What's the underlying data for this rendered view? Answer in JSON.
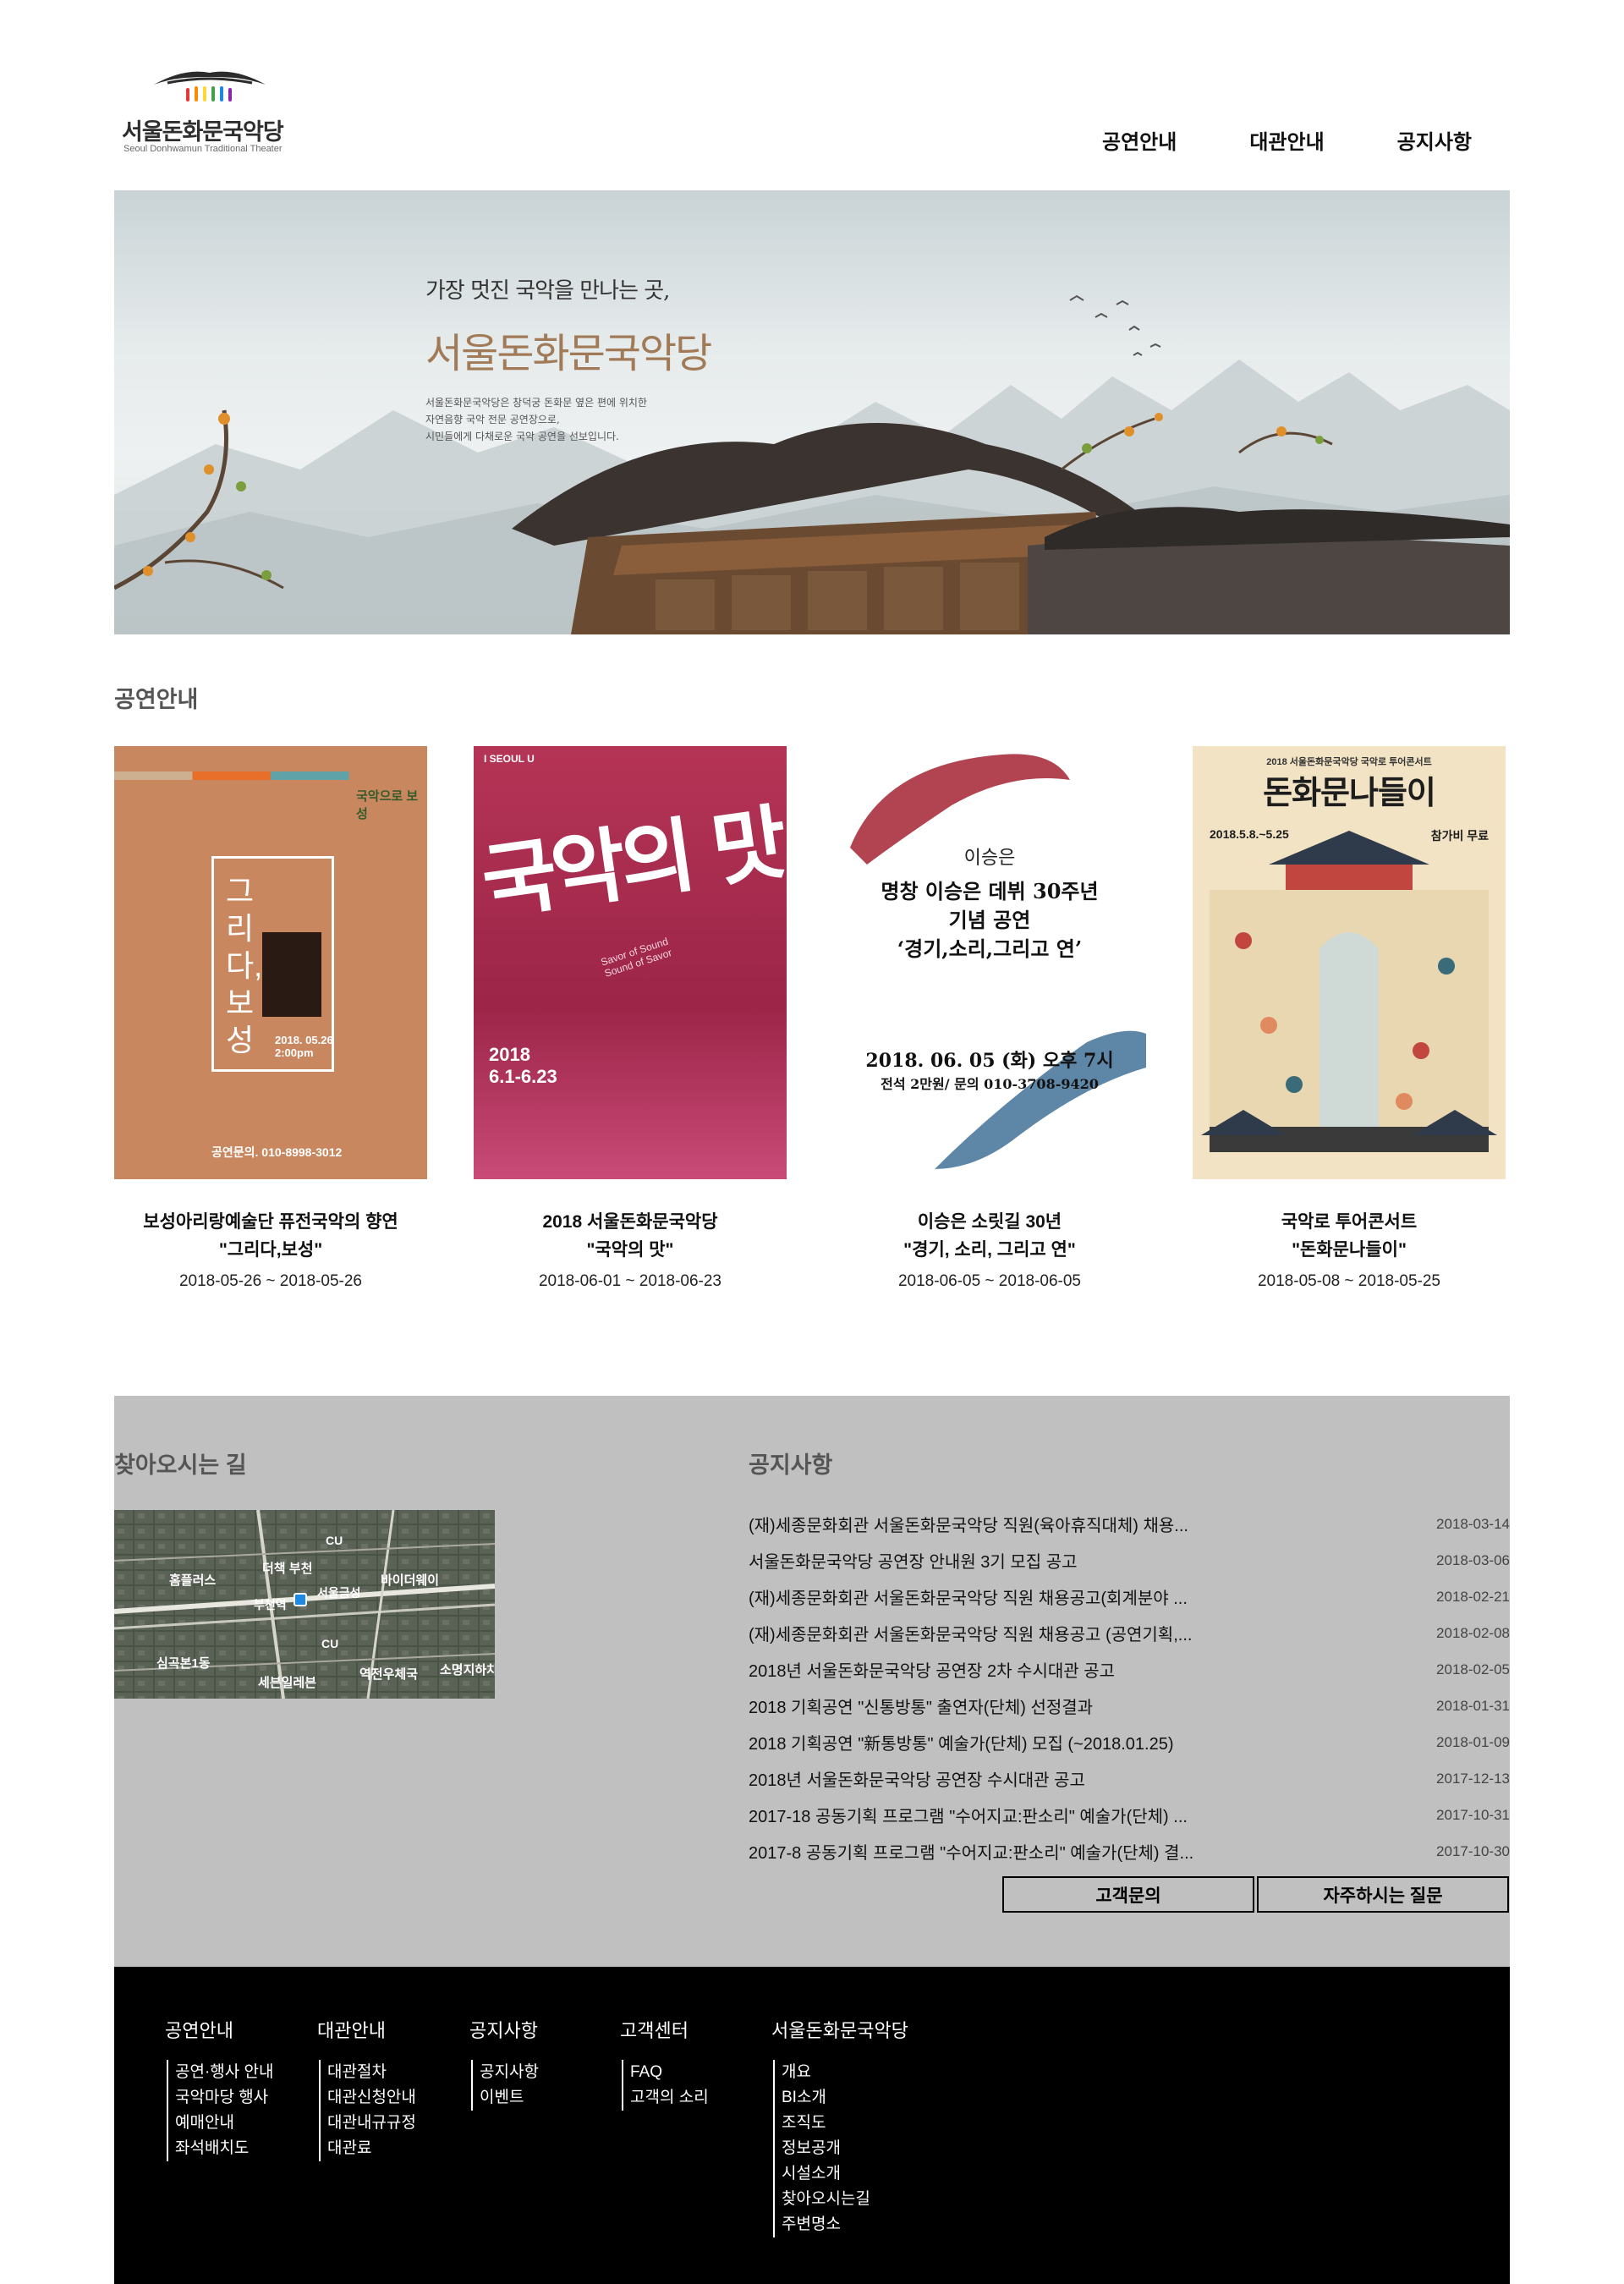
{
  "header": {
    "logo_name": "서울돈화문국악당",
    "logo_en": "Seoul Donhwamun Traditional Theater",
    "nav": [
      "공연안내",
      "대관안내",
      "공지사항"
    ]
  },
  "hero": {
    "subtitle": "가장 멋진 국악을 만나는 곳,",
    "title": "서울돈화문국악당",
    "desc_lines": [
      "서울돈화문국악당은 창덕궁 돈화문 옆은 편에 위치한",
      "자연음향 국악 전문 공연장으로,",
      "시민들에게 다채로운 국악 공연을 선보입니다."
    ]
  },
  "performances": {
    "title": "공연안내",
    "items": [
      {
        "name_line1": "보성아리랑예술단 퓨전국악의 향연",
        "name_line2": "\"그리다,보성\"",
        "date": "2018-05-26 ~ 2018-05-26",
        "poster": {
          "badge": "국악으로 보성",
          "vertical_title": "그리다,보성",
          "date_text": "2018. 05.26 2:00pm",
          "contact": "공연문의. 010-8998-3012",
          "bg": "#c8875f"
        }
      },
      {
        "name_line1": "2018 서울돈화문국악당",
        "name_line2": "\"국악의 맛\"",
        "date": "2018-06-01 ~ 2018-06-23",
        "poster": {
          "brand": "I SEOUL U",
          "big_title": "국악의 맛",
          "subtitle_en": "Savor of Sound Sound of Savor",
          "year": "2018",
          "period": "6.1-6.23",
          "bg": "#a2294a"
        }
      },
      {
        "name_line1": "이승은 소릿길 30년",
        "name_line2": "\"경기, 소리, 그리고 연\"",
        "date": "2018-06-05 ~ 2018-06-05",
        "poster": {
          "name": "이승은",
          "line1": "명창 이승은 데뷔 30주년",
          "line2": "기념 공연",
          "line3": "‘경기,소리,그리고 연’",
          "datetime": "2018. 06. 05 (화) 오후 7시",
          "price": "전석 2만원/ 문의 010-3708-9420",
          "bg": "#ffffff"
        }
      },
      {
        "name_line1": "국악로 투어콘서트",
        "name_line2": "\"돈화문나들이\"",
        "date": "2018-05-08 ~ 2018-05-25",
        "poster": {
          "top": "2018 서울돈화문국악당 국악로 투어콘서트",
          "big_title": "돈화문나들이",
          "period": "2018.5.8.~5.25",
          "free": "참가비 무료",
          "bg": "#f2e3c4"
        }
      }
    ]
  },
  "directions": {
    "title": "찾아오시는 길",
    "map_labels": [
      "CU",
      "더책 부천",
      "홈플러스",
      "바이더웨이",
      "서울금성",
      "부천역",
      "CU",
      "심곡본1동",
      "세븐일레븐",
      "역전우체국",
      "소명지하차"
    ]
  },
  "notices": {
    "title": "공지사항",
    "items": [
      {
        "text": "(재)세종문화회관 서울돈화문국악당 직원(육아휴직대체) 채용...",
        "date": "2018-03-14"
      },
      {
        "text": "서울돈화문국악당 공연장 안내원 3기 모집 공고",
        "date": "2018-03-06"
      },
      {
        "text": "(재)세종문화회관 서울돈화문국악당 직원 채용공고(회계분야 ...",
        "date": "2018-02-21"
      },
      {
        "text": "(재)세종문화회관 서울돈화문국악당 직원 채용공고 (공연기획,...",
        "date": "2018-02-08"
      },
      {
        "text": "2018년 서울돈화문국악당 공연장 2차 수시대관 공고",
        "date": "2018-02-05"
      },
      {
        "text": "2018 기획공연 \"신통방통\" 출연자(단체) 선정결과",
        "date": "2018-01-31"
      },
      {
        "text": "2018 기획공연 \"新통방통\" 예술가(단체) 모집 (~2018.01.25)",
        "date": "2018-01-09"
      },
      {
        "text": "2018년 서울돈화문국악당 공연장 수시대관 공고",
        "date": "2017-12-13"
      },
      {
        "text": "2017-18 공동기획 프로그램 \"수어지교:판소리\" 예술가(단체) ...",
        "date": "2017-10-31"
      },
      {
        "text": "2017-8 공동기획 프로그램 \"수어지교:판소리\" 예술가(단체) 결...",
        "date": "2017-10-30"
      }
    ],
    "btn_inquiry": "고객문의",
    "btn_faq": "자주하시는 질문"
  },
  "footer": {
    "columns": [
      {
        "title": "공연안내",
        "items": [
          "공연·행사 안내",
          "국악마당 행사",
          "예매안내",
          "좌석배치도"
        ]
      },
      {
        "title": "대관안내",
        "items": [
          "대관절차",
          "대관신청안내",
          "대관내규규정",
          "대관료"
        ]
      },
      {
        "title": "공지사항",
        "items": [
          "공지사항",
          "이벤트"
        ]
      },
      {
        "title": "고객센터",
        "items": [
          "FAQ",
          "고객의 소리"
        ]
      },
      {
        "title": "서울돈화문국악당",
        "items": [
          "개요",
          "BI소개",
          "조직도",
          "정보공개",
          "시설소개",
          "찾아오시는길",
          "주변명소"
        ]
      }
    ]
  },
  "colors": {
    "grey_section": "#c0c0c0",
    "footer_bg": "#000000",
    "hero_title": "#a17a58"
  }
}
